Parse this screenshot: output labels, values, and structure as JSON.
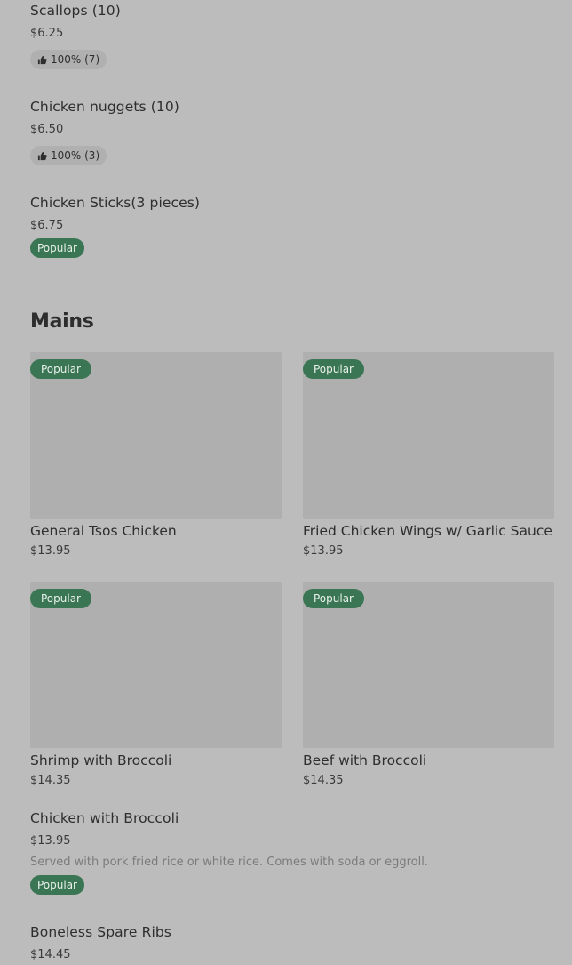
{
  "top_items": [
    {
      "name": "Scallops (10)",
      "price": "$6.25",
      "rating": "100% (7)"
    },
    {
      "name": "Chicken nuggets (10)",
      "price": "$6.50",
      "rating": "100% (3)"
    },
    {
      "name": "Chicken Sticks(3 pieces)",
      "price": "$6.75",
      "badge": "Popular"
    }
  ],
  "mains": {
    "title": "Mains",
    "cards": [
      {
        "name": "General Tsos Chicken",
        "price": "$13.95",
        "badge": "Popular"
      },
      {
        "name": "Fried Chicken Wings w/ Garlic Sauce",
        "price": "$13.95",
        "badge": "Popular"
      },
      {
        "name": "Shrimp with Broccoli",
        "price": "$14.35",
        "badge": "Popular"
      },
      {
        "name": "Beef with Broccoli",
        "price": "$14.35",
        "badge": "Popular"
      }
    ],
    "list_items": [
      {
        "name": "Chicken with Broccoli",
        "price": "$13.95",
        "description": "Served with pork fried rice or white rice. Comes with soda or eggroll.",
        "badge": "Popular"
      },
      {
        "name": "Boneless Spare Ribs",
        "price": "$14.45"
      }
    ]
  },
  "colors": {
    "background": "#bcbcbc",
    "popular_badge": "#3b7654",
    "rating_badge": "#b0b0b0",
    "image_placeholder": "#afafaf"
  },
  "icons": {
    "rating": "thumbs-up-icon"
  }
}
